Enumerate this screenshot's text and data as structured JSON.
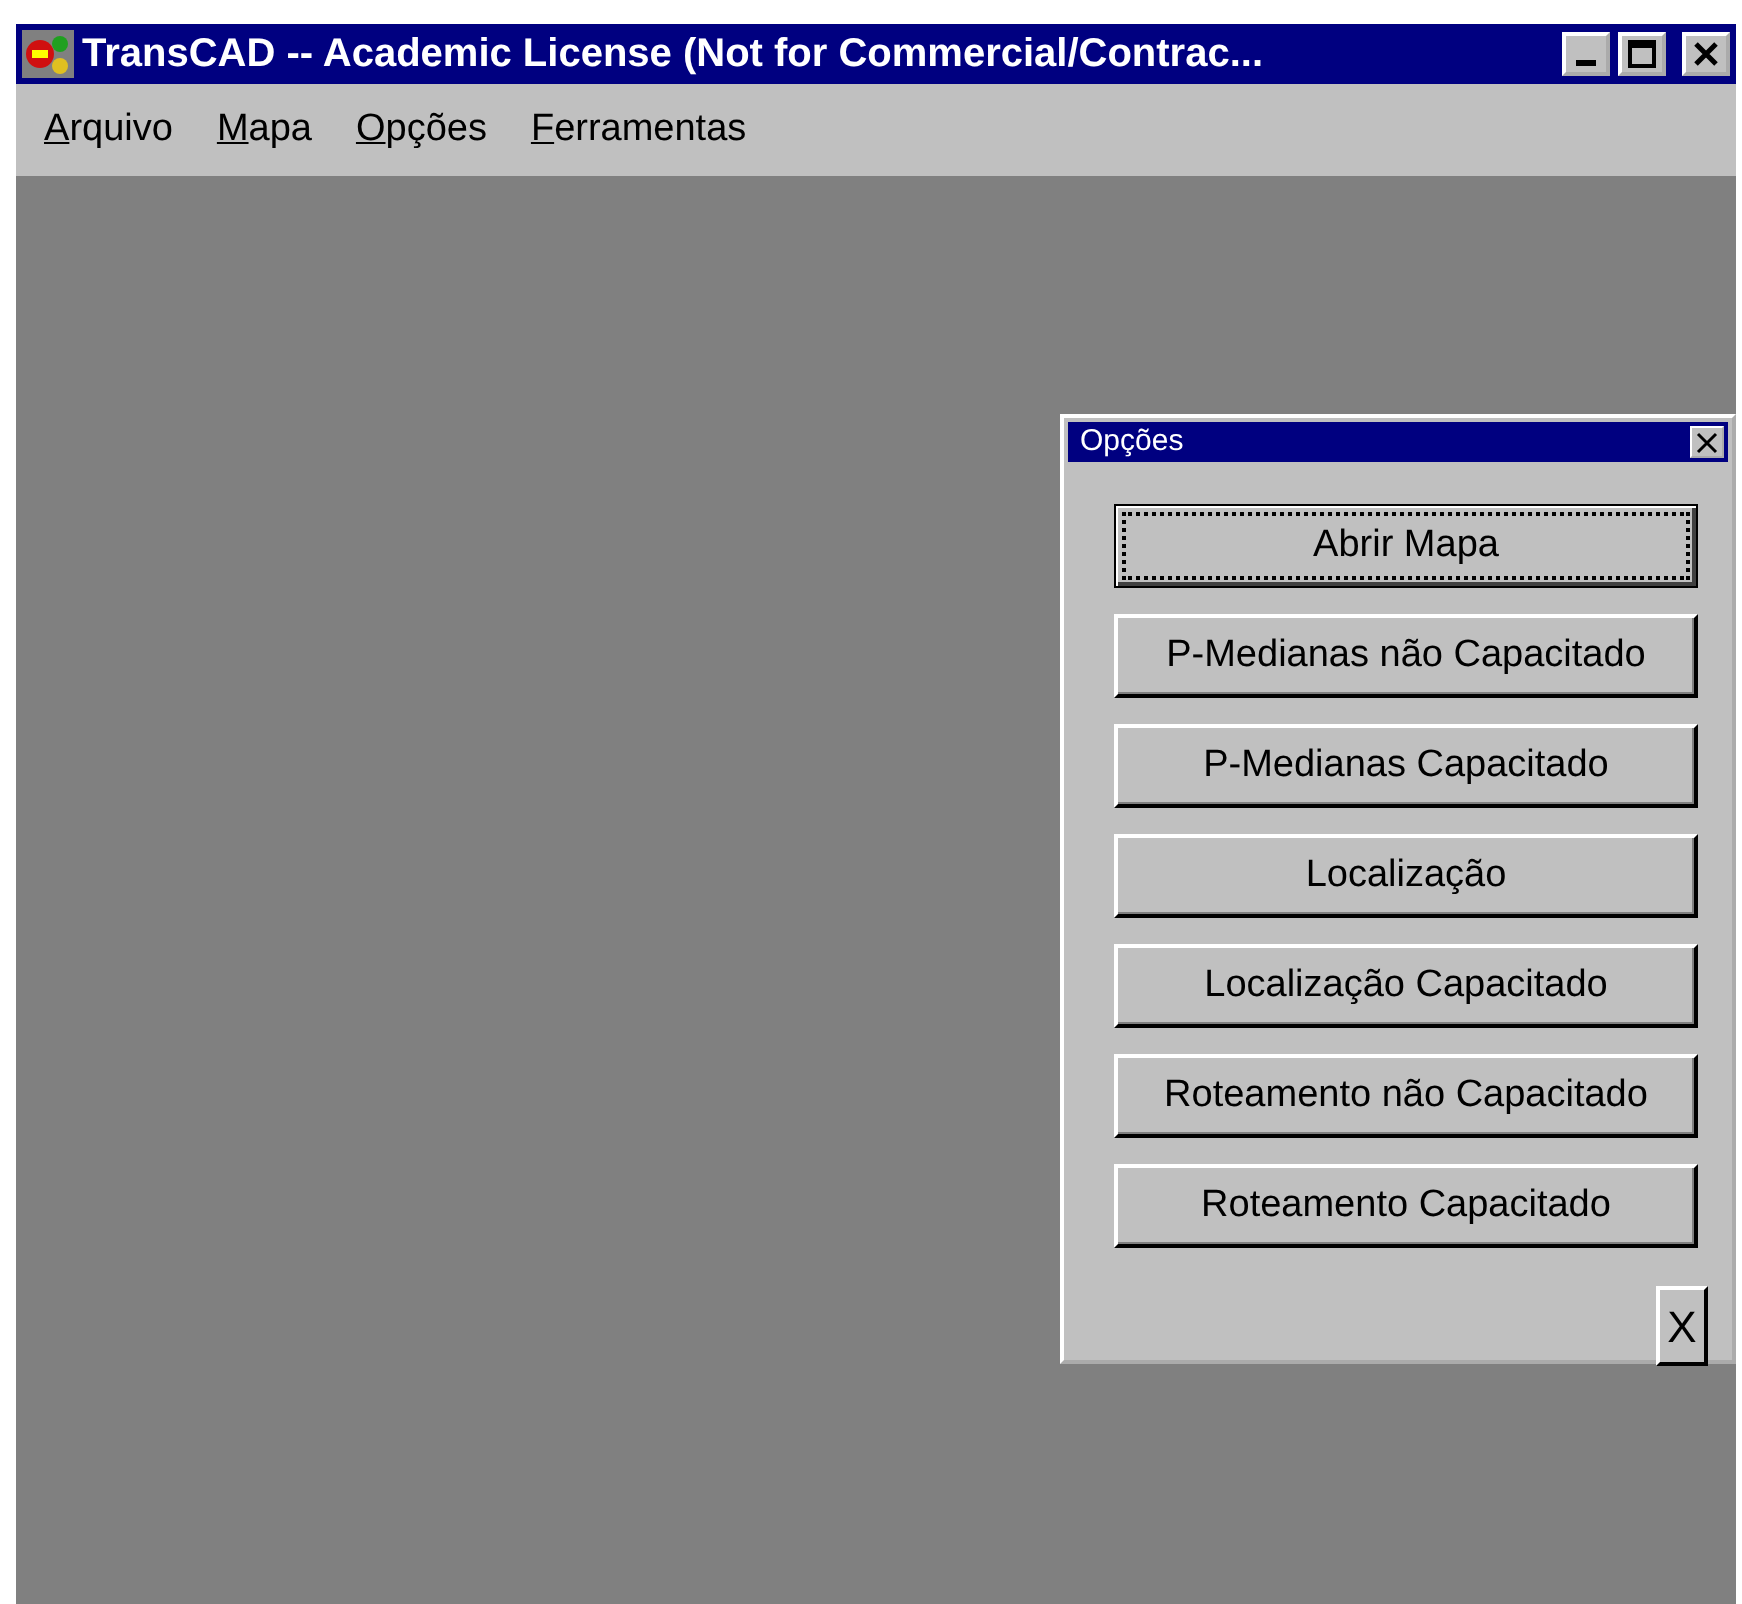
{
  "window": {
    "title": "TransCAD -- Academic License (Not for Commercial/Contrac..."
  },
  "menu": [
    "Arquivo",
    "Mapa",
    "Opções",
    "Ferramentas"
  ],
  "palette": {
    "title": "Opções",
    "buttons": [
      {
        "label": "Abrir Mapa",
        "focused": true
      },
      {
        "label": "P-Medianas não Capacitado",
        "focused": false
      },
      {
        "label": "P-Medianas Capacitado",
        "focused": false
      },
      {
        "label": "Localização",
        "focused": false
      },
      {
        "label": "Localização Capacitado",
        "focused": false
      },
      {
        "label": "Roteamento não Capacitado",
        "focused": false
      },
      {
        "label": "Roteamento Capacitado",
        "focused": false
      }
    ],
    "close_button": "X"
  }
}
